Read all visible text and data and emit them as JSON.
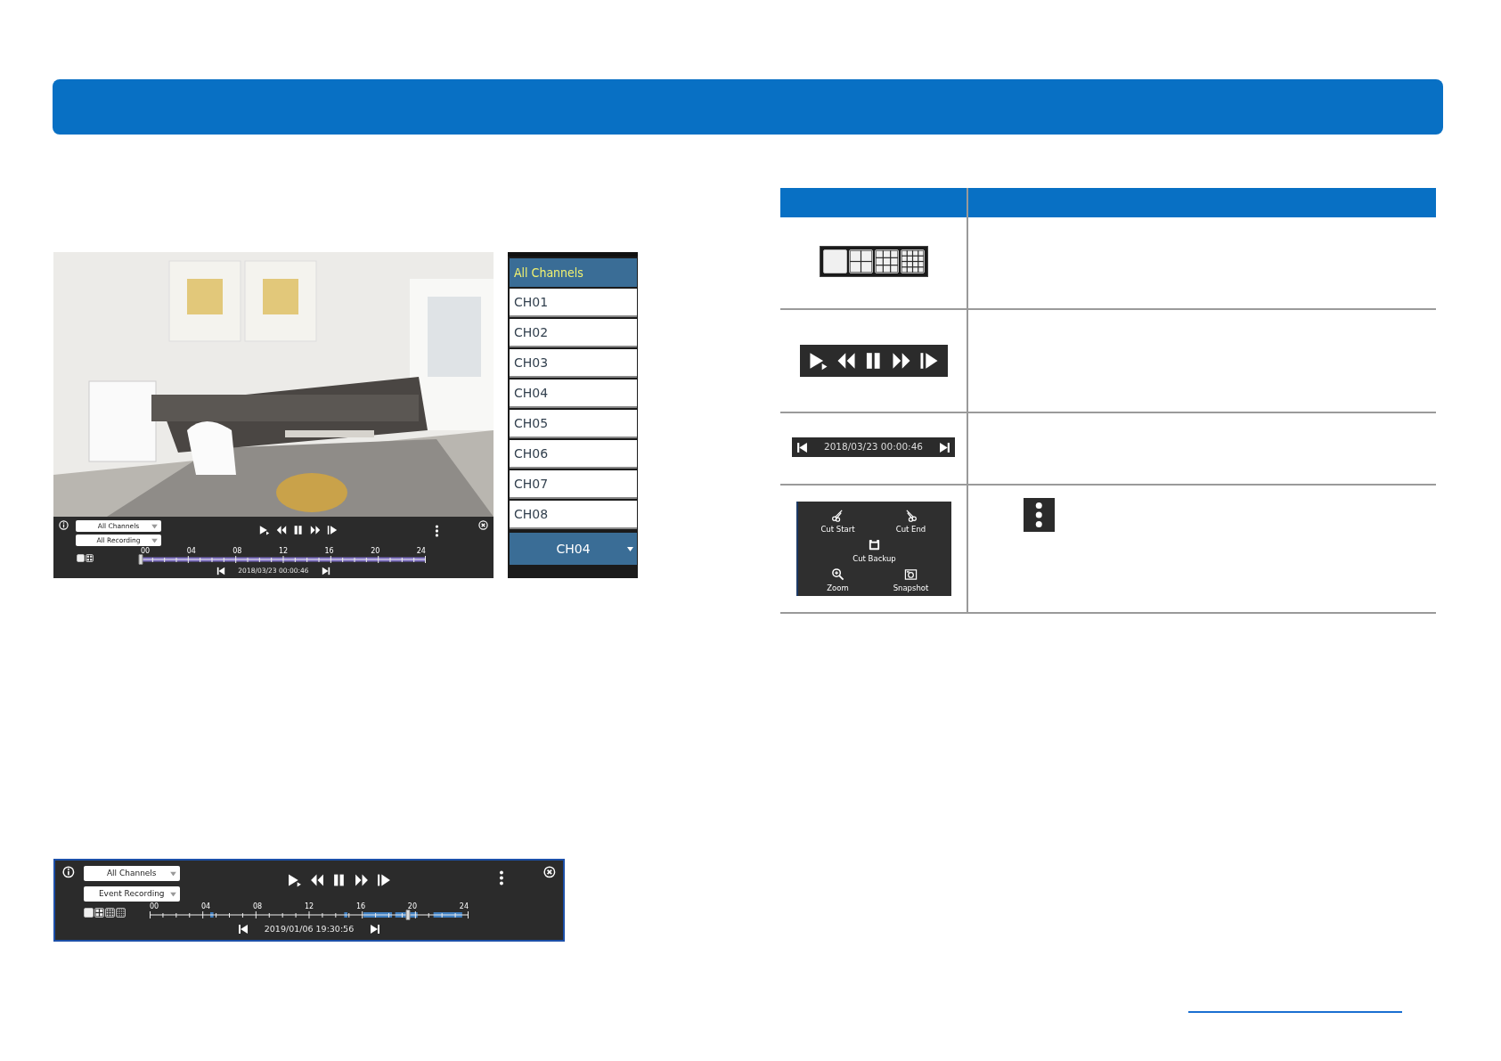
{
  "playback_screenshot": {
    "channel_select": "All Channels",
    "recording_select": "All Recording",
    "layouts": [
      {
        "kind": "single",
        "selected": true
      },
      {
        "kind": "quad",
        "selected": false
      }
    ],
    "timeline": {
      "kind": "continuous",
      "labels": [
        "00",
        "04",
        "08",
        "12",
        "16",
        "20",
        "24"
      ],
      "level": 0
    },
    "date": "2018/03/23 00:00:46"
  },
  "channel_list": {
    "header": "All Channels",
    "items": [
      {
        "label": "CH01"
      },
      {
        "label": "CH02"
      },
      {
        "label": "CH03"
      },
      {
        "label": "CH04"
      },
      {
        "label": "CH05"
      },
      {
        "label": "CH06"
      },
      {
        "label": "CH07"
      },
      {
        "label": "CH08"
      }
    ],
    "current": "CH04"
  },
  "table": {
    "rows": [
      {
        "kind": "layouts",
        "layouts": [
          {
            "kind": "single",
            "selected": true
          },
          {
            "kind": "quad",
            "selected": false
          },
          {
            "kind": "nine",
            "selected": false
          },
          {
            "kind": "sixteen",
            "selected": false
          }
        ]
      },
      {
        "kind": "controls"
      },
      {
        "kind": "date_nav",
        "date": "2018/03/23 00:00:46"
      },
      {
        "kind": "menu",
        "items": [
          {
            "kind": "cut_start",
            "label": "Cut Start"
          },
          {
            "kind": "cut_end",
            "label": "Cut End"
          },
          {
            "kind": "cut_backup",
            "label": "Cut Backup"
          },
          {
            "kind": "zoom",
            "label": "Zoom"
          },
          {
            "kind": "snapshot",
            "label": "Snapshot"
          }
        ]
      }
    ]
  },
  "event_bar": {
    "channel_select": "All Channels",
    "recording_select": "Event Recording",
    "layouts": [
      {
        "kind": "single",
        "selected": true
      },
      {
        "kind": "quad",
        "selected": false
      },
      {
        "kind": "nine",
        "selected": false
      },
      {
        "kind": "sixteen",
        "selected": false
      }
    ],
    "timeline": {
      "kind": "event",
      "labels": [
        "00",
        "04",
        "08",
        "12",
        "16",
        "20",
        "24"
      ],
      "level": 0.81
    },
    "date": "2019/01/06 19:30:56"
  }
}
